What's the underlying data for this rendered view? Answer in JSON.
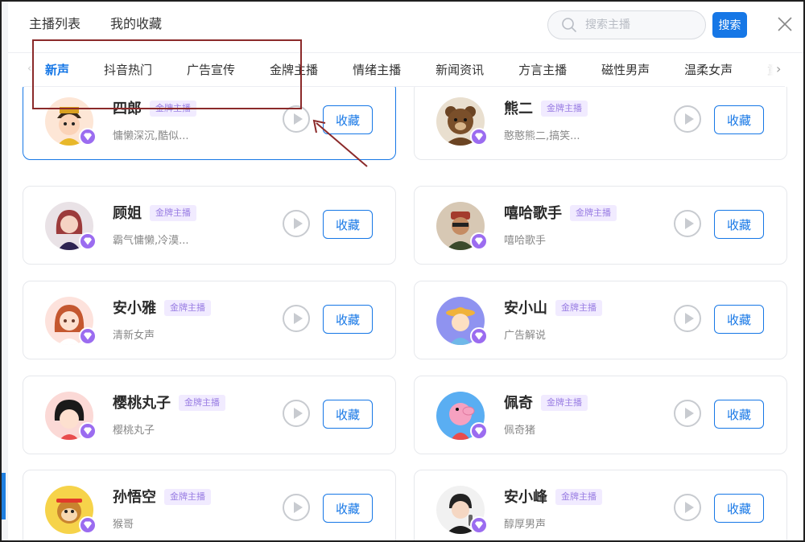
{
  "header": {
    "tabs": [
      "主播列表",
      "我的收藏"
    ],
    "search": {
      "placeholder": "搜索主播",
      "button_label": "搜索"
    }
  },
  "categories": {
    "items": [
      "新声",
      "抖音热门",
      "广告宣传",
      "金牌主播",
      "情绪主播",
      "新闻资讯",
      "方言主播",
      "磁性男声",
      "温柔女声",
      "童声"
    ],
    "active_index": 0
  },
  "anchors": [
    {
      "name": "四郎",
      "tag": "金牌主播",
      "desc": "慵懒深沉,酷似...",
      "fav_label": "收藏",
      "avatar": "emperor-boy",
      "selected": true
    },
    {
      "name": "熊二",
      "tag": "金牌主播",
      "desc": "憨憨熊二,搞笑...",
      "fav_label": "收藏",
      "avatar": "bear"
    },
    {
      "name": "顾姐",
      "tag": "金牌主播",
      "desc": "霸气慵懒,冷漠...",
      "fav_label": "收藏",
      "avatar": "woman"
    },
    {
      "name": "嘻哈歌手",
      "tag": "金牌主播",
      "desc": "嘻哈歌手",
      "fav_label": "收藏",
      "avatar": "hiphop"
    },
    {
      "name": "安小雅",
      "tag": "金牌主播",
      "desc": "清新女声",
      "fav_label": "收藏",
      "avatar": "girl"
    },
    {
      "name": "安小山",
      "tag": "金牌主播",
      "desc": "广告解说",
      "fav_label": "收藏",
      "avatar": "boy-hat"
    },
    {
      "name": "樱桃丸子",
      "tag": "金牌主播",
      "desc": "樱桃丸子",
      "fav_label": "收藏",
      "avatar": "maruko"
    },
    {
      "name": "佩奇",
      "tag": "金牌主播",
      "desc": "佩奇猪",
      "fav_label": "收藏",
      "avatar": "peppa"
    },
    {
      "name": "孙悟空",
      "tag": "金牌主播",
      "desc": "猴哥",
      "fav_label": "收藏",
      "avatar": "monkey"
    },
    {
      "name": "安小峰",
      "tag": "金牌主播",
      "desc": "醇厚男声",
      "fav_label": "收藏",
      "avatar": "man-mic"
    }
  ],
  "colors": {
    "accent": "#1677e6",
    "badge_purple": "#9b6cf0",
    "annotation": "#8b2a2a"
  }
}
